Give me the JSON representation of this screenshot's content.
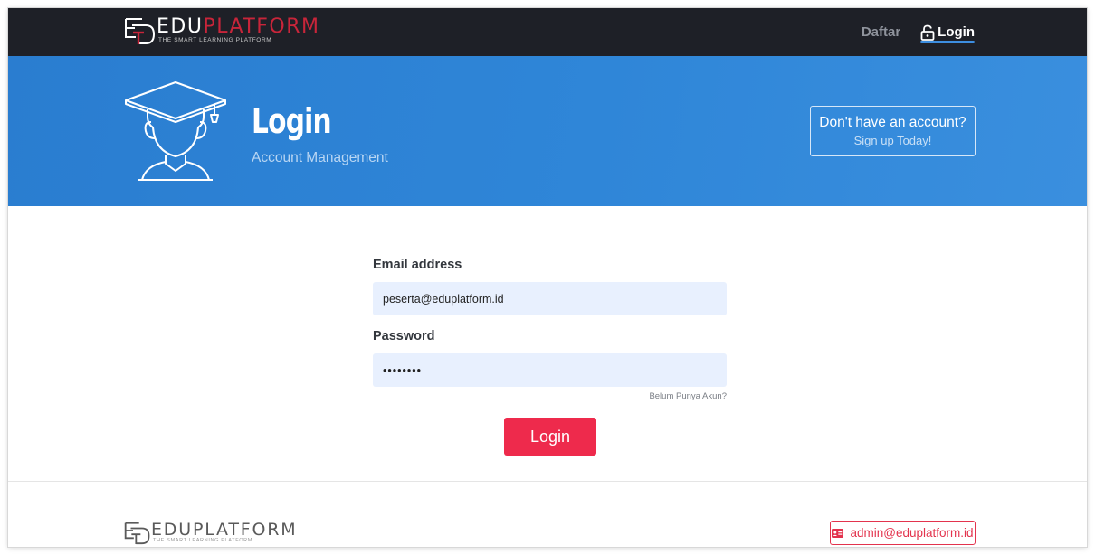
{
  "header": {
    "logo": {
      "word_white": "EDU",
      "word_red": "PLATFORM",
      "tagline": "THE SMART LEARNING PLATFORM"
    },
    "nav": [
      {
        "label": "Daftar",
        "active": false
      },
      {
        "label": "Login",
        "active": true,
        "icon": "lock-icon"
      }
    ]
  },
  "hero": {
    "icon": "graduate-icon",
    "title": "Login",
    "subtitle": "Account Management",
    "signup": {
      "question": "Don't have an account?",
      "cta": "Sign up Today!"
    }
  },
  "form": {
    "email_label": "Email address",
    "email_value": "peserta@eduplatform.id",
    "password_label": "Password",
    "password_value": "••••••••",
    "no_account_link": "Belum Punya Akun?",
    "submit_label": "Login"
  },
  "footer": {
    "logo": {
      "word": "EDUPLATFORM",
      "tagline": "THE SMART LEARNING PLATFORM"
    },
    "email_icon": "id-card-icon",
    "email": "admin@eduplatform.id"
  },
  "colors": {
    "nav_bg": "#1e2027",
    "hero_bg": "#2f86d8",
    "accent_red": "#ee2a4c",
    "input_bg": "#e8f0fe",
    "active_underline": "#3d8ee0"
  }
}
